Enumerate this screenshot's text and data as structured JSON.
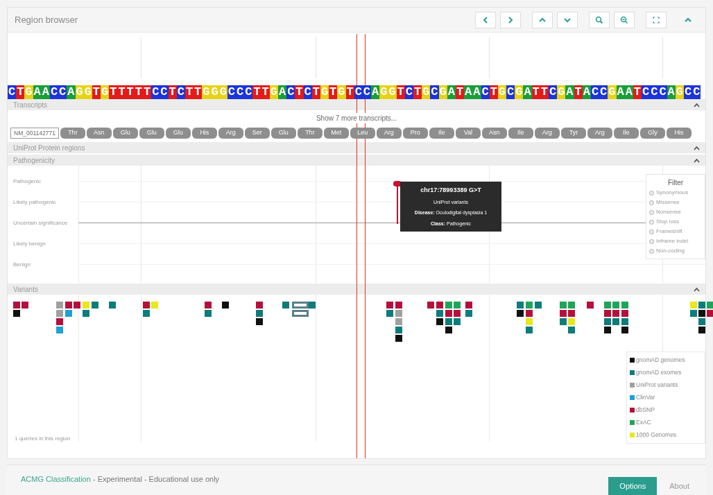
{
  "region_browser": {
    "title": "Region browser",
    "buttons": [
      {
        "kind": "left"
      },
      {
        "kind": "right"
      },
      {
        "kind": "up"
      },
      {
        "kind": "down"
      },
      {
        "kind": "zoom-in"
      },
      {
        "kind": "zoom-out"
      },
      {
        "kind": "fullscreen"
      },
      {
        "kind": "collapse"
      }
    ]
  },
  "sequence": "CTGAACCAGGTGTTTTTCCTCTTGGGCCCTTGACTCTGTGTCCAGGTCTGCGATAACTGCGATTCGATACCGAATCCCAGCC",
  "transcripts": {
    "title": "Transcripts",
    "expanded": true,
    "show_more": "Show 7 more transcripts...",
    "transcript": "NM_001142771",
    "residues": [
      "Thr",
      "Asn",
      "Glu",
      "Glu",
      "Glu",
      "His",
      "Arg",
      "Ser",
      "Glu",
      "Thr",
      "Met",
      "Leu",
      "Arg",
      "Pro",
      "Ile",
      "Val",
      "Asn",
      "Ile",
      "Arg",
      "Tyr",
      "Arg",
      "Ile",
      "Gly",
      "His"
    ]
  },
  "uniprot_regions": {
    "title": "UniProt Protein regions",
    "expanded": true
  },
  "pathogenicity": {
    "title": "Pathogenicity",
    "expanded": true,
    "levels": [
      "Pathogenic",
      "Likely pathogenic",
      "Uncertain significance",
      "Likely benign",
      "Benign"
    ],
    "tooltip": {
      "title": "chr17:78993389 G>T",
      "source": "UniProt variants",
      "disease": "**Disease:** Oculodigital dysplasia 1",
      "class": "**Class:** Pathogenic"
    },
    "filter": {
      "title": "Filter",
      "options": [
        {
          "label": "Synonymous",
          "selected": false
        },
        {
          "label": "Missense",
          "selected": false
        },
        {
          "label": "Nonsense",
          "selected": false
        },
        {
          "label": "Stop loss",
          "selected": false
        },
        {
          "label": "Frameshift",
          "selected": false
        },
        {
          "label": "Inframe indel",
          "selected": false
        },
        {
          "label": "Non-coding",
          "selected": false
        }
      ]
    }
  },
  "variants": {
    "title": "Variants",
    "expanded": true,
    "queries": "1 queries in this region",
    "columns": [
      [
        {
          "color": "#b5103d"
        },
        {
          "color": "#111111"
        }
      ],
      [
        {
          "color": "#b5103d"
        }
      ],
      [
        {
          "color": "#a0a0a0"
        },
        {
          "color": "#a0a0a0"
        },
        {
          "color": "#b5103d"
        },
        {
          "color": "#1ea0d8"
        }
      ],
      [
        {
          "color": "#b5103d"
        },
        {
          "color": "#1ea0d8"
        }
      ],
      [
        {
          "color": "#b5103d"
        }
      ],
      [
        {
          "color": "#e8e81a"
        },
        {
          "color": "#0e7c7b"
        }
      ],
      [
        {
          "color": "#0e7c7b"
        }
      ],
      [
        {
          "color": "#0e7c7b"
        }
      ],
      [
        {
          "color": "#b5103d"
        },
        {
          "color": "#0e7c7b"
        }
      ],
      [
        {
          "color": "#e8e81a"
        }
      ],
      [
        {
          "color": "#b5103d"
        },
        {
          "color": "#0e7c7b"
        }
      ],
      [
        {
          "color": "#111111"
        }
      ],
      [
        {
          "color": "#b5103d"
        },
        {
          "color": "#0e7c7b"
        },
        {
          "color": "#111111"
        }
      ],
      [
        {
          "color": "#0e7c7b"
        }
      ],
      [
        {
          "color": "#5b7e88",
          "kind": "outline"
        },
        {
          "color": "#5b7e88",
          "kind": "outline"
        }
      ],
      [
        {
          "color": "#0e7c7b"
        }
      ],
      [
        {
          "color": "#b5103d"
        },
        {
          "color": "#0e7c7b"
        }
      ],
      [
        {
          "color": "#b5103d"
        },
        {
          "color": "#a0a0a0"
        },
        {
          "color": "#a0a0a0"
        },
        {
          "color": "#0e7c7b"
        },
        {
          "color": "#111111"
        }
      ],
      [
        {
          "color": "#b5103d"
        }
      ],
      [
        {
          "color": "#b5103d"
        },
        {
          "color": "#0e7c7b"
        },
        {
          "color": "#111111"
        }
      ],
      [
        {
          "color": "#1fa55a"
        },
        {
          "color": "#b5103d"
        },
        {
          "color": "#0e7c7b"
        },
        {
          "color": "#111111"
        }
      ],
      [
        {
          "color": "#1fa55a"
        },
        {
          "color": "#b5103d"
        },
        {
          "color": "#0e7c7b"
        }
      ],
      [
        {
          "color": "#b5103d"
        },
        {
          "color": "#0e7c7b"
        }
      ],
      [
        {
          "color": "#0e7c7b"
        },
        {
          "color": "#111111"
        }
      ],
      [
        {
          "color": "#1fa55a"
        },
        {
          "color": "#b5103d"
        },
        {
          "color": "#e8e81a"
        },
        {
          "color": "#0e7c7b"
        }
      ],
      [
        {
          "color": "#0e7c7b"
        }
      ],
      [
        {
          "color": "#1fa55a"
        },
        {
          "color": "#b5103d"
        },
        {
          "color": "#0e7c7b"
        }
      ],
      [
        {
          "color": "#1fa55a"
        },
        {
          "color": "#b5103d"
        },
        {
          "color": "#e8e81a"
        },
        {
          "color": "#0e7c7b"
        }
      ],
      [
        {
          "color": "#b5103d"
        }
      ],
      [
        {
          "color": "#1fa55a"
        },
        {
          "color": "#b5103d"
        },
        {
          "color": "#0e7c7b"
        },
        {
          "color": "#111111"
        }
      ],
      [
        {
          "color": "#1fa55a"
        },
        {
          "color": "#b5103d"
        },
        {
          "color": "#0e7c7b"
        }
      ],
      [
        {
          "color": "#1fa55a"
        },
        {
          "color": "#b5103d"
        },
        {
          "color": "#0e7c7b"
        },
        {
          "color": "#111111"
        }
      ],
      [
        {
          "color": "#e8e81a"
        },
        {
          "color": "#0e7c7b"
        }
      ],
      [
        {
          "color": "#0e7c7b"
        },
        {
          "color": "#111111"
        },
        {
          "color": "#0e7c7b"
        },
        {
          "color": "#111111"
        }
      ],
      [
        {
          "color": "#1fa55a"
        },
        {
          "color": "#b5103d"
        }
      ]
    ],
    "legend": [
      {
        "label": "gnomAD genomes",
        "color": "#111111"
      },
      {
        "label": "gnomAD exomes",
        "color": "#0e7c7b"
      },
      {
        "label": "UniProt variants",
        "color": "#a0a0a0"
      },
      {
        "label": "ClinVar",
        "color": "#1ea0d8"
      },
      {
        "label": "dbSNP",
        "color": "#b5103d"
      },
      {
        "label": "ExAC",
        "color": "#1fa55a"
      },
      {
        "label": "1000 Genomes",
        "color": "#e8e81a"
      }
    ]
  },
  "footer": {
    "link": "ACMG Classification",
    "text": " - Experimental - Educational use only",
    "buttons": [
      "Options",
      "About"
    ]
  }
}
